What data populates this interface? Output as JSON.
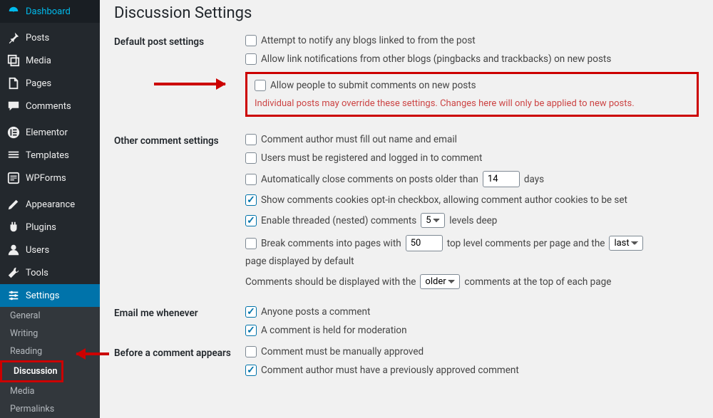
{
  "sidebar": {
    "items": [
      {
        "label": "Dashboard",
        "icon": "dashboard"
      },
      {
        "label": "Posts",
        "icon": "pin"
      },
      {
        "label": "Media",
        "icon": "media"
      },
      {
        "label": "Pages",
        "icon": "pages"
      },
      {
        "label": "Comments",
        "icon": "comments"
      },
      {
        "label": "Elementor",
        "icon": "elementor"
      },
      {
        "label": "Templates",
        "icon": "templates"
      },
      {
        "label": "WPForms",
        "icon": "wpforms"
      },
      {
        "label": "Appearance",
        "icon": "appearance"
      },
      {
        "label": "Plugins",
        "icon": "plugins"
      },
      {
        "label": "Users",
        "icon": "users"
      },
      {
        "label": "Tools",
        "icon": "tools"
      },
      {
        "label": "Settings",
        "icon": "settings"
      }
    ],
    "subitems": [
      {
        "label": "General"
      },
      {
        "label": "Writing"
      },
      {
        "label": "Reading"
      },
      {
        "label": "Discussion",
        "current": true
      },
      {
        "label": "Media"
      },
      {
        "label": "Permalinks"
      }
    ]
  },
  "page": {
    "title": "Discussion Settings"
  },
  "sections": {
    "default_post": {
      "heading": "Default post settings",
      "opt1": "Attempt to notify any blogs linked to from the post",
      "opt2": "Allow link notifications from other blogs (pingbacks and trackbacks) on new posts",
      "opt3": "Allow people to submit comments on new posts",
      "desc": "Individual posts may override these settings. Changes here will only be applied to new posts."
    },
    "other_comment": {
      "heading": "Other comment settings",
      "opt1": "Comment author must fill out name and email",
      "opt2": "Users must be registered and logged in to comment",
      "opt3a": "Automatically close comments on posts older than",
      "opt3_val": "14",
      "opt3b": "days",
      "opt4": "Show comments cookies opt-in checkbox, allowing comment author cookies to be set",
      "opt5a": "Enable threaded (nested) comments",
      "opt5_val": "5",
      "opt5b": "levels deep",
      "opt6a": "Break comments into pages with",
      "opt6_val": "50",
      "opt6b": "top level comments per page and the",
      "opt6_sel": "last",
      "opt6c": "page displayed by default",
      "opt7a": "Comments should be displayed with the",
      "opt7_sel": "older",
      "opt7b": "comments at the top of each page"
    },
    "email_me": {
      "heading": "Email me whenever",
      "opt1": "Anyone posts a comment",
      "opt2": "A comment is held for moderation"
    },
    "before_appears": {
      "heading": "Before a comment appears",
      "opt1": "Comment must be manually approved",
      "opt2": "Comment author must have a previously approved comment"
    }
  }
}
